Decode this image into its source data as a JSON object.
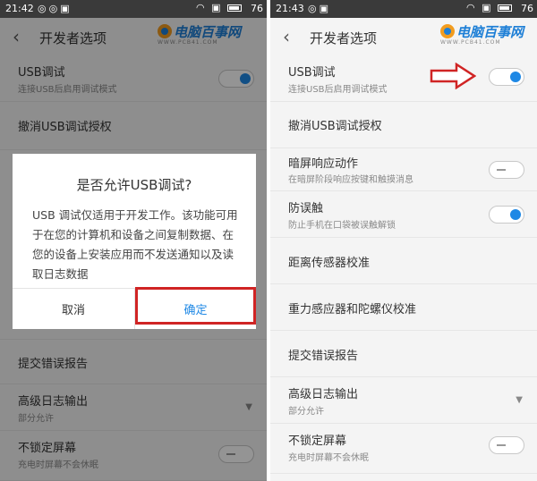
{
  "left": {
    "status": {
      "time": "21:42",
      "battery": "76"
    },
    "title": "开发者选项",
    "watermark": {
      "text": "电脑百事网",
      "sub": "WWW.PCB41.COM"
    },
    "items": {
      "usb": {
        "label": "USB调试",
        "desc": "连接USB后启用调试模式"
      },
      "revoke": {
        "label": "撤消USB调试授权"
      },
      "bugreport": {
        "label": "提交错误报告"
      },
      "log": {
        "label": "高级日志输出",
        "desc": "部分允许"
      },
      "unlock": {
        "label": "不锁定屏幕",
        "desc": "充电时屏幕不会休眠"
      }
    },
    "dialog": {
      "title": "是否允许USB调试?",
      "body": "USB 调试仅适用于开发工作。该功能可用于在您的计算机和设备之间复制数据、在您的设备上安装应用而不发送通知以及读取日志数据",
      "cancel": "取消",
      "ok": "确定"
    }
  },
  "right": {
    "status": {
      "time": "21:43",
      "battery": "76"
    },
    "title": "开发者选项",
    "watermark": {
      "text": "电脑百事网",
      "sub": "WWW.PCB41.COM"
    },
    "items": {
      "usb": {
        "label": "USB调试",
        "desc": "连接USB后启用调试模式",
        "on": true
      },
      "revoke": {
        "label": "撤消USB调试授权"
      },
      "darkscreen": {
        "label": "暗屏响应动作",
        "desc": "在暗屏阶段响应按键和触摸消息",
        "on": false
      },
      "mistouch": {
        "label": "防误触",
        "desc": "防止手机在口袋被误触解锁",
        "on": true
      },
      "proximity": {
        "label": "距离传感器校准"
      },
      "gravity": {
        "label": "重力感应器和陀螺仪校准"
      },
      "bugreport": {
        "label": "提交错误报告"
      },
      "log": {
        "label": "高级日志输出",
        "desc": "部分允许"
      },
      "unlock": {
        "label": "不锁定屏幕",
        "desc": "充电时屏幕不会休眠",
        "on": false
      }
    }
  },
  "colors": {
    "accent": "#1e88e5",
    "highlight": "#d02424",
    "statusbar": "#3a3a3a"
  },
  "icons": [
    "back-arrow-icon",
    "wifi-icon",
    "signal-icon",
    "battery-icon",
    "chevron-down-icon",
    "red-arrow-icon"
  ]
}
